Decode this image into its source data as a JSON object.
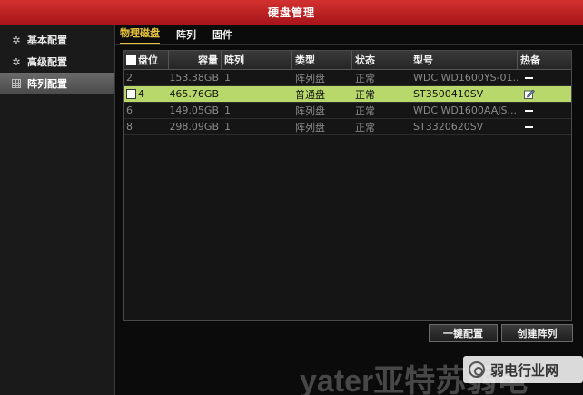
{
  "window": {
    "title": "硬盘管理"
  },
  "sidebar": {
    "items": [
      {
        "label": "基本配置",
        "icon": "gear-icon",
        "active": false
      },
      {
        "label": "高级配置",
        "icon": "gear-icon",
        "active": false
      },
      {
        "label": "阵列配置",
        "icon": "grid-icon",
        "active": true
      }
    ]
  },
  "tabs": [
    {
      "label": "物理磁盘",
      "active": true
    },
    {
      "label": "阵列",
      "active": false
    },
    {
      "label": "固件",
      "active": false
    }
  ],
  "table": {
    "headers": {
      "bay": "盘位",
      "capacity": "容量",
      "array": "阵列",
      "type": "类型",
      "status": "状态",
      "model": "型号",
      "hotspare": "热备"
    },
    "rows": [
      {
        "bay": "2",
        "capacity": "153.38GB",
        "array": "1",
        "type": "阵列盘",
        "status": "正常",
        "model": "WDC WD1600YS-01...",
        "hotspare": "dash",
        "selected": false,
        "checkbox": false
      },
      {
        "bay": "4",
        "capacity": "465.76GB",
        "array": "",
        "type": "普通盘",
        "status": "正常",
        "model": "ST3500410SV",
        "hotspare": "edit",
        "selected": true,
        "checkbox": true
      },
      {
        "bay": "6",
        "capacity": "149.05GB",
        "array": "1",
        "type": "阵列盘",
        "status": "正常",
        "model": "WDC WD1600AAJS...",
        "hotspare": "dash",
        "selected": false,
        "checkbox": false
      },
      {
        "bay": "8",
        "capacity": "298.09GB",
        "array": "1",
        "type": "阵列盘",
        "status": "正常",
        "model": "ST3320620SV",
        "hotspare": "dash",
        "selected": false,
        "checkbox": false
      }
    ]
  },
  "buttons": {
    "quick_config": "一键配置",
    "create_array": "创建阵列"
  },
  "watermark": {
    "text": "yater亚特苏弱电",
    "badge_text": "弱电行业网"
  },
  "colors": {
    "title_bar": "#c0232a",
    "selected_row": "#b9d86b",
    "active_tab": "#e8c33a"
  }
}
